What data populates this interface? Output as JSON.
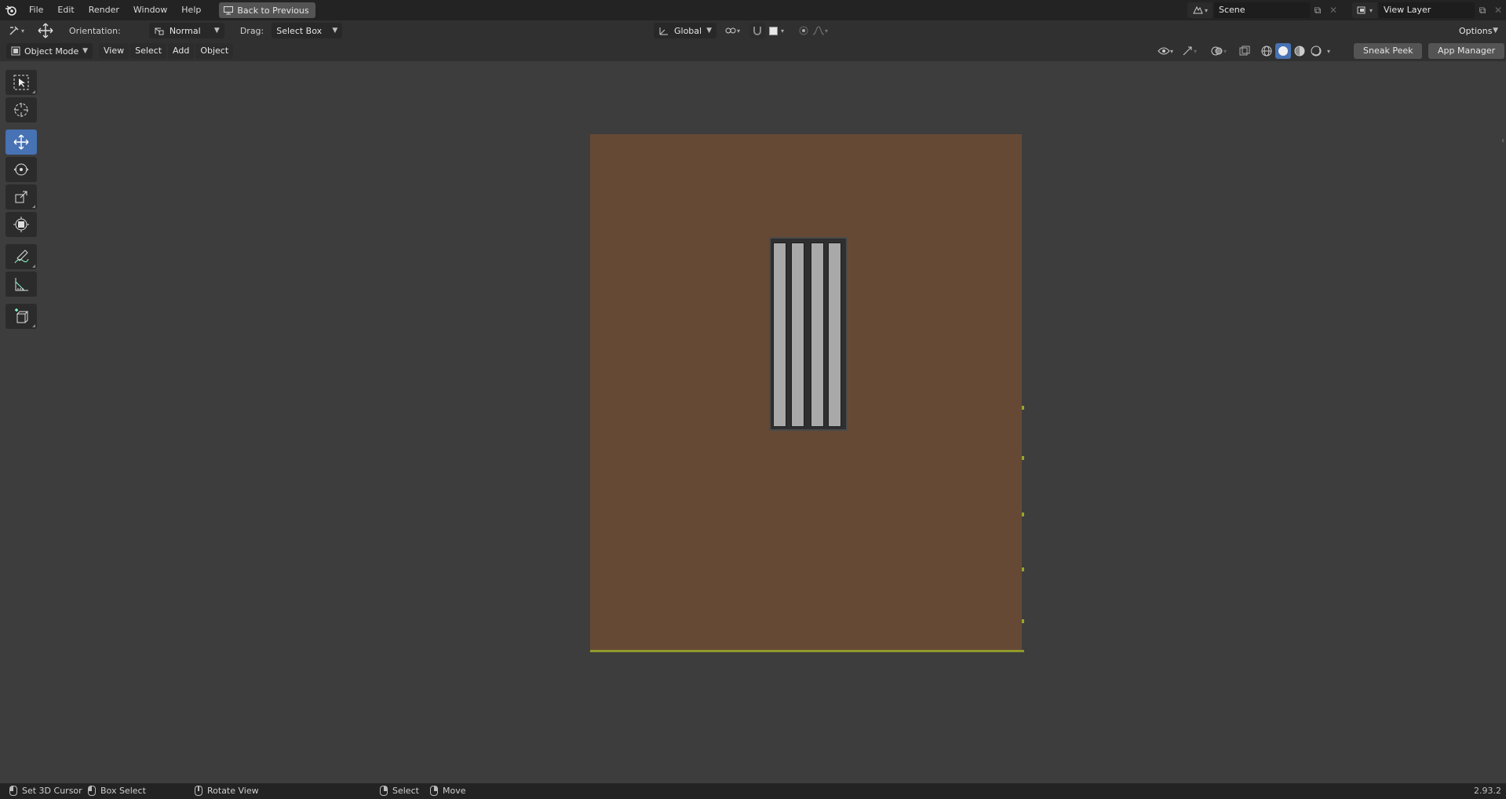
{
  "topbar": {
    "menus": [
      "File",
      "Edit",
      "Render",
      "Window",
      "Help"
    ],
    "back_button": "Back to Previous",
    "scene": "Scene",
    "view_layer": "View Layer"
  },
  "header1": {
    "orientation_label": "Orientation:",
    "orientation_value": "Normal",
    "drag_label": "Drag:",
    "drag_value": "Select Box",
    "transform_orientation": "Global",
    "options": "Options"
  },
  "header2": {
    "mode": "Object Mode",
    "menus": [
      "View",
      "Select",
      "Add",
      "Object"
    ],
    "sneak_peek": "Sneak Peek",
    "app_manager": "App Manager"
  },
  "toolbar": {
    "tools": [
      "select-box-tool",
      "cursor-tool",
      "move-tool",
      "rotate-tool",
      "scale-tool",
      "transform-tool",
      "annotate-tool",
      "measure-tool",
      "add-cube-tool"
    ],
    "active_tool": "move-tool"
  },
  "colors": {
    "wall": "#664935",
    "accent": "#4772b3",
    "edge_highlight": "#8f9a2a"
  },
  "statusbar": {
    "set_cursor": "Set 3D Cursor",
    "box_select": "Box Select",
    "rotate_view": "Rotate View",
    "select": "Select",
    "move": "Move",
    "version": "2.93.2"
  }
}
